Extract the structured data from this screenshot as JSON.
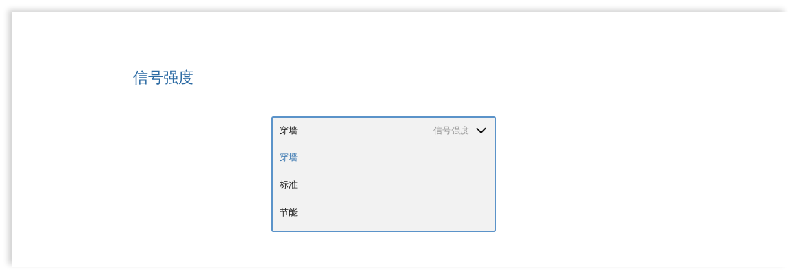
{
  "section": {
    "title": "信号强度"
  },
  "dropdown": {
    "value": "穿墙",
    "label": "信号强度",
    "expanded": true,
    "options": [
      {
        "label": "穿墙",
        "selected": true
      },
      {
        "label": "标准",
        "selected": false
      },
      {
        "label": "节能",
        "selected": false
      }
    ]
  }
}
